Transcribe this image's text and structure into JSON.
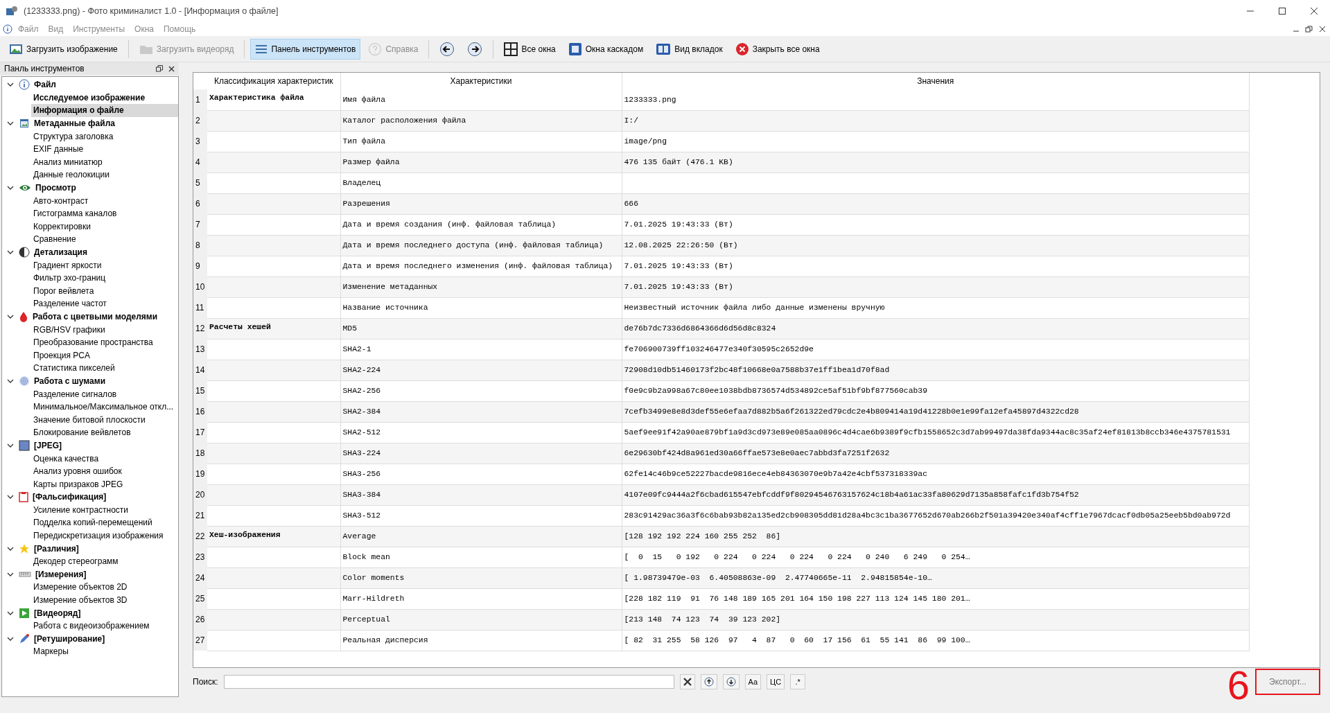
{
  "window": {
    "title": "(1233333.png) - Фото криминалист 1.0 - [Информация о файле]"
  },
  "menu": [
    "Файл",
    "Вид",
    "Инструменты",
    "Окна",
    "Помощь"
  ],
  "toolbar": [
    {
      "label": "Загрузить изображение",
      "disabled": false,
      "selected": false
    },
    {
      "label": "Загрузить видеоряд",
      "disabled": true,
      "selected": false
    },
    {
      "label": "Панель инструментов",
      "disabled": false,
      "selected": true
    },
    {
      "label": "Справка",
      "disabled": true,
      "selected": false
    },
    {
      "disabled": false,
      "selected": false
    },
    {
      "disabled": false,
      "selected": false
    },
    {
      "label": "Все окна",
      "disabled": false,
      "selected": false
    },
    {
      "label": "Окна каскадом",
      "disabled": false,
      "selected": false
    },
    {
      "label": "Вид вкладок",
      "disabled": false,
      "selected": false
    },
    {
      "label": "Закрыть все окна",
      "disabled": false,
      "selected": false
    }
  ],
  "sidebar": {
    "title": "Панль инструментов",
    "items": [
      {
        "label": "Файл",
        "expanded": true,
        "children": [
          {
            "label": "Исследуемое изображение",
            "open": true,
            "selected": false
          },
          {
            "label": "Информация о файле",
            "open": true,
            "selected": true
          }
        ]
      },
      {
        "label": "Метаданные файла",
        "expanded": true,
        "children": [
          {
            "label": "Структура заголовка",
            "open": false,
            "selected": false
          },
          {
            "label": "EXIF данные",
            "open": false,
            "selected": false
          },
          {
            "label": "Анализ миниатюр",
            "open": false,
            "selected": false
          },
          {
            "label": "Данные геолокиции",
            "open": false,
            "selected": false
          }
        ]
      },
      {
        "label": "Просмотр",
        "expanded": true,
        "children": [
          {
            "label": "Авто-контраст",
            "open": false,
            "selected": false
          },
          {
            "label": "Гистограмма каналов",
            "open": false,
            "selected": false
          },
          {
            "label": "Корректировки",
            "open": false,
            "selected": false
          },
          {
            "label": "Сравнение",
            "open": false,
            "selected": false
          }
        ]
      },
      {
        "label": "Детализация",
        "expanded": true,
        "children": [
          {
            "label": "Градиент яркости",
            "open": false,
            "selected": false
          },
          {
            "label": "Фильтр эхо-границ",
            "open": false,
            "selected": false
          },
          {
            "label": "Порог вейвлета",
            "open": false,
            "selected": false
          },
          {
            "label": "Разделение частот",
            "open": false,
            "selected": false
          }
        ]
      },
      {
        "label": "Работа с цветвыми моделями",
        "expanded": true,
        "children": [
          {
            "label": "RGB/HSV графики",
            "open": false,
            "selected": false
          },
          {
            "label": "Преобразование пространства",
            "open": false,
            "selected": false
          },
          {
            "label": "Проекция PCA",
            "open": false,
            "selected": false
          },
          {
            "label": "Статистика пикселей",
            "open": false,
            "selected": false
          }
        ]
      },
      {
        "label": "Работа с шумами",
        "expanded": true,
        "children": [
          {
            "label": "Разделение сигналов",
            "open": false,
            "selected": false
          },
          {
            "label": "Минимальное/Максимальное откл...",
            "open": false,
            "selected": false
          },
          {
            "label": "Значение битовой плоскости",
            "open": false,
            "selected": false
          },
          {
            "label": "Блокирование вейвлетов",
            "open": false,
            "selected": false
          }
        ]
      },
      {
        "label": "[JPEG]",
        "expanded": true,
        "children": [
          {
            "label": "Оценка качества",
            "open": false,
            "selected": false
          },
          {
            "label": "Анализ уровня ошибок",
            "open": false,
            "selected": false
          },
          {
            "label": "Карты призраков JPEG",
            "open": false,
            "selected": false
          }
        ]
      },
      {
        "label": "[Фальсификация]",
        "expanded": true,
        "children": [
          {
            "label": "Усиление контрастности",
            "open": false,
            "selected": false
          },
          {
            "label": "Подделка копий-перемещений",
            "open": false,
            "selected": false
          },
          {
            "label": "Передискретизация изображения",
            "open": false,
            "selected": false
          }
        ]
      },
      {
        "label": "[Различия]",
        "expanded": true,
        "children": [
          {
            "label": "Декодер стереограмм",
            "open": false,
            "selected": false
          }
        ]
      },
      {
        "label": "[Измерения]",
        "expanded": true,
        "children": [
          {
            "label": "Измерение объектов 2D",
            "open": false,
            "selected": false
          },
          {
            "label": "Измерение объектов 3D",
            "open": false,
            "selected": false
          }
        ]
      },
      {
        "label": "[Видеоряд]",
        "expanded": true,
        "children": [
          {
            "label": "Работа с видеоизображением",
            "open": false,
            "selected": false
          }
        ]
      },
      {
        "label": "[Ретуширование]",
        "expanded": true,
        "children": [
          {
            "label": "Маркеры",
            "open": false,
            "selected": false
          }
        ]
      }
    ]
  },
  "table": {
    "columns": [
      "Классификация характеристик",
      "Характеристики",
      "Значения"
    ],
    "rows": [
      {
        "num": "1",
        "group": "Характеристика файла",
        "name": "Имя файла",
        "value": "1233333.png"
      },
      {
        "num": "2",
        "name": "Каталог расположения файла",
        "value": "I:/"
      },
      {
        "num": "3",
        "name": "Тип файла",
        "value": "image/png"
      },
      {
        "num": "4",
        "name": "Размер файла",
        "value": "476 135 байт (476.1 KB)"
      },
      {
        "num": "5",
        "name": "Владелец"
      },
      {
        "num": "6",
        "name": "Разрешения",
        "value": "666"
      },
      {
        "num": "7",
        "name": "Дата и время создания (инф. файловая таблица)",
        "value": "7.01.2025 19:43:33 (Вт)"
      },
      {
        "num": "8",
        "name": "Дата и время последнего доступа (инф. файловая таблица)",
        "value": "12.08.2025 22:26:50 (Вт)"
      },
      {
        "num": "9",
        "name": "Дата и время последнего изменения (инф. файловая таблица)",
        "value": "7.01.2025 19:43:33 (Вт)"
      },
      {
        "num": "10",
        "name": "Изменение метаданных",
        "value": "7.01.2025 19:43:33 (Вт)"
      },
      {
        "num": "11",
        "name": "Название источника",
        "value": "Неизвестный источник файла либо данные изменены вручную"
      },
      {
        "num": "12",
        "group": "Расчеты хешей",
        "name": "MD5",
        "value": "de76b7dc7336d6864366d6d56d8c8324"
      },
      {
        "num": "13",
        "name": "SHA2-1",
        "value": "fe706900739ff103246477e340f30595c2652d9e"
      },
      {
        "num": "14",
        "name": "SHA2-224",
        "value": "72908d10db51460173f2bc48f10668e0a7588b37e1ff1bea1d70f8ad"
      },
      {
        "num": "15",
        "name": "SHA2-256",
        "value": "f0e9c9b2a998a67c80ee1038bdb8736574d534892ce5af51bf9bf877560cab39"
      },
      {
        "num": "16",
        "name": "SHA2-384",
        "value": "7cefb3499e8e8d3def55e6efaa7d882b5a6f261322ed79cdc2e4b809414a19d41228b0e1e99fa12efa45897d4322cd28"
      },
      {
        "num": "17",
        "name": "SHA2-512",
        "value": "5aef9ee91f42a90ae879bf1a9d3cd973e89e085aa0896c4d4cae6b9389f9cfb1558652c3d7ab99497da38fda9344ac8c35af24ef81813b8ccb346e4375781531"
      },
      {
        "num": "18",
        "name": "SHA3-224",
        "value": "6e29630bf424d8a961ed30a66ffae573e8e0aec7abbd3fa7251f2632"
      },
      {
        "num": "19",
        "name": "SHA3-256",
        "value": "62fe14c46b9ce52227bacde9816ece4eb84363070e9b7a42e4cbf537318339ac"
      },
      {
        "num": "20",
        "name": "SHA3-384",
        "value": "4107e09fc9444a2f6cbad615547ebfcddf9f80294546763157624c18b4a61ac33fa80629d7135a858fafc1fd3b754f52"
      },
      {
        "num": "21",
        "name": "SHA3-512",
        "value": "283c91429ac36a3f6c6bab93b82a135ed2cb908305dd81d28a4bc3c1ba3677652d670ab266b2f501a39420e340af4cff1e7967dcacf0db05a25eeb5bd0ab972d"
      },
      {
        "num": "22",
        "group": "Хеш-изображения",
        "name": "Average",
        "value": "[128 192 192 224 160 255 252  86]"
      },
      {
        "num": "23",
        "name": "Block mean",
        "value": "[  0  15   0 192   0 224   0 224   0 224   0 224   0 240   6 249   0 254…"
      },
      {
        "num": "24",
        "name": "Color moments",
        "value": "[ 1.98739479e-03  6.40508863e-09  2.47740665e-11  2.94815854e-10…"
      },
      {
        "num": "25",
        "name": "Marr-Hildreth",
        "value": "[228 182 119  91  76 148 189 165 201 164 150 198 227 113 124 145 180 201…"
      },
      {
        "num": "26",
        "name": "Perceptual",
        "value": "[213 148  74 123  74  39 123 202]"
      },
      {
        "num": "27",
        "name": "Реальная дисперсия",
        "value": "[ 82  31 255  58 126  97   4  87   0  60  17 156  61  55 141  86  99 100…"
      }
    ]
  },
  "search": {
    "label": "Поиск:",
    "buttons": [
      "Aa",
      "ЦС",
      ".*"
    ]
  },
  "annotation": "6",
  "export": {
    "label": "Экспорт...",
    "highlighted": true
  }
}
